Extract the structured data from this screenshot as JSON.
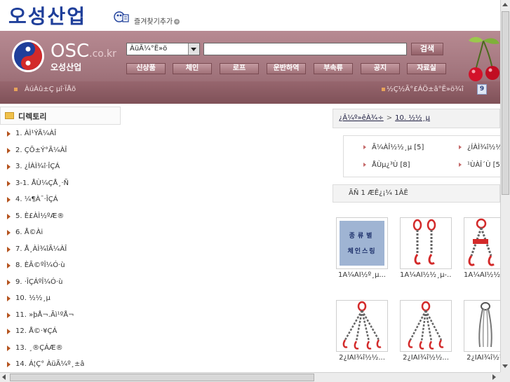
{
  "top": {
    "brand_kr": "오성산업",
    "favorite_label": "즐겨찾기추가"
  },
  "header": {
    "logo_text": "OSC",
    "logo_domain": ".co.kr",
    "logo_kr": "오성산업",
    "search_select_value": "ÀüÃ¼°Ë»ö",
    "search_input_value": "",
    "search_button": "검색",
    "nav": [
      "신상품",
      "체인",
      "로프",
      "운반하역",
      "부속류",
      "공지",
      "자료실"
    ],
    "sub_left": "ÀúÀû±Ç µî·ÏÅõ",
    "sub_right": "½Ç½Ã°£ÁÖ±â°Ë»ö¾î",
    "page_badge": "9"
  },
  "colors": {
    "header_maroon": "#a3767e",
    "brand_blue": "#1f3f9a",
    "bullet_orange": "#b5541f",
    "chain_red": "#d32a2a"
  },
  "sidebar": {
    "title": "디렉토리",
    "items": [
      "1. ÀÌ¹ÝÃ¼ÀÎ",
      "2. ÇÕ±Ý°­Ã¼ÀÎ",
      "3. ¿ÍÀÌ¾î·ÎÇÁ",
      "3-1. ÅÙ¼ÇÅ¸·Ñ",
      "4. ¼¶À¯·ÎÇÁ",
      "5. È£ÀÌ½ºÆ®",
      "6. Å©Ài",
      "7. Å¸ÀÌ¾îÃ¼ÀÎ",
      "8. ÈÃ©ºÎ¼Ó·ù",
      "9. ·ÎÇÁºÎ¼Ó·ù",
      "10. ½½¸µ",
      "11. »þÅ¬.Ãì¹ºÅ¬",
      "12. Å©·¥ÇÁ",
      "13. ¸®ÇÁÆ®",
      "14. Á¦Ç° ÀüÃ¼º¸±â"
    ]
  },
  "main": {
    "breadcrumb_root": "¿Â¼º»êÀ¾÷",
    "breadcrumb_current": "10. ½½¸µ",
    "categories": [
      "Ã¼ÀÎ½½¸µ [5]",
      "¿ÍÀÌ¾î½½",
      "ÅÙµ¿³Ù [8]",
      "¹ÙÀÎ´Ù [5"
    ],
    "count_text": "ÃÑ 1 ÆÊ¿¡¼ 1ÂÊ",
    "products": [
      {
        "caption": "1Ã¼ÀÎ½º¸µ...",
        "sign_line1": "종류별",
        "sign_line2": "체인스링"
      },
      {
        "caption": "1Ã¼ÀÎ½½¸µ-..."
      },
      {
        "caption": "1Ã¼ÀÎ½½¸µ-..."
      },
      {
        "caption": "2¿ÍÀÌ¾î½½..."
      },
      {
        "caption": "2¿ÍÀÌ¾î½½..."
      },
      {
        "caption": "2¿ÍÀÌ¾î½½..."
      }
    ]
  }
}
